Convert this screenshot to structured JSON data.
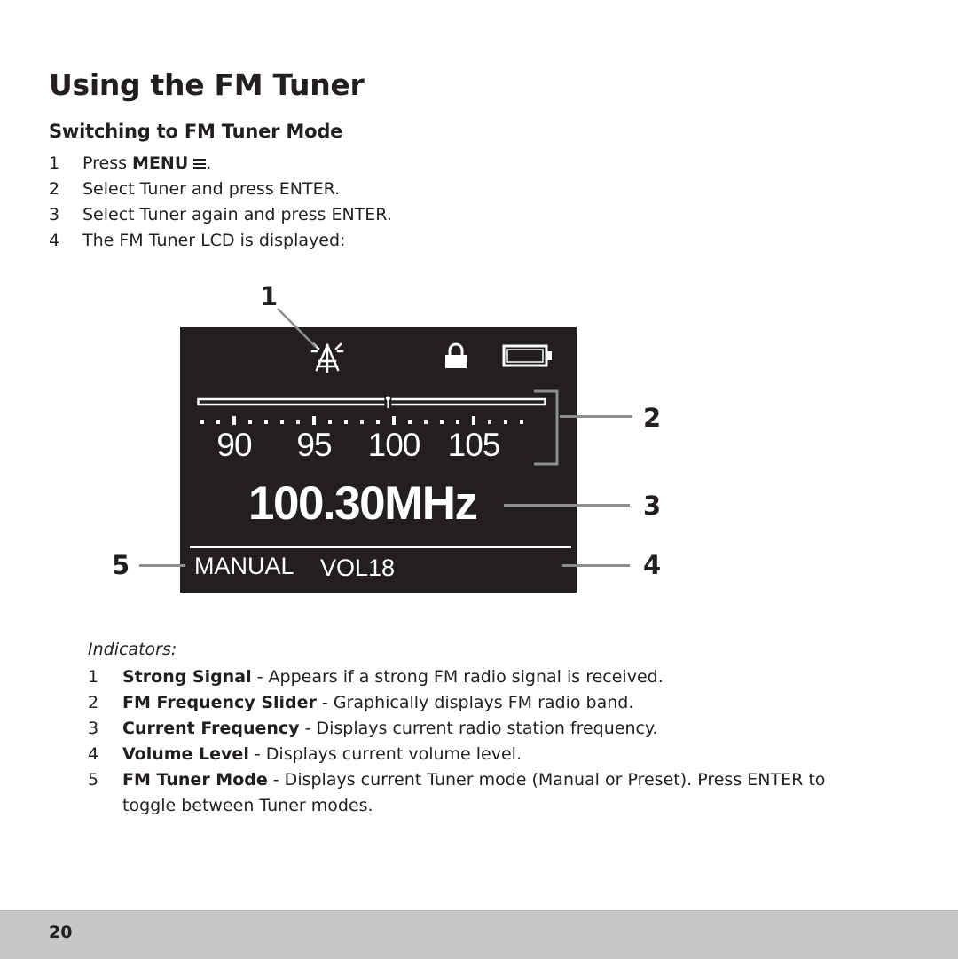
{
  "page": {
    "title": "Using the FM Tuner",
    "subtitle": "Switching to FM Tuner Mode",
    "page_number": "20"
  },
  "steps": [
    {
      "num": "1",
      "prefix": "Press ",
      "bold": "MENU",
      "icon": "menu-icon",
      "suffix": "."
    },
    {
      "num": "2",
      "text": "Select Tuner and press ENTER."
    },
    {
      "num": "3",
      "text": "Select Tuner again and press ENTER."
    },
    {
      "num": "4",
      "text": "The FM Tuner LCD is displayed:"
    }
  ],
  "lcd": {
    "icons": [
      "strong-signal-icon",
      "lock-icon",
      "battery-icon"
    ],
    "scale_labels": [
      "90",
      "95",
      "100",
      "105"
    ],
    "scale_range_mhz": [
      87.5,
      108
    ],
    "current_frequency_mhz": 100.3,
    "frequency_text": "100.30MHz",
    "mode": "MANUAL",
    "volume": "VOL18",
    "battery_level": 1.0
  },
  "callouts": [
    "1",
    "2",
    "3",
    "4",
    "5"
  ],
  "indicators": {
    "label": "Indicators:",
    "items": [
      {
        "num": "1",
        "term": "Strong Signal",
        "desc": " - Appears if a strong FM radio signal is received."
      },
      {
        "num": "2",
        "term": "FM Frequency Slider",
        "desc": " - Graphically displays FM radio band."
      },
      {
        "num": "3",
        "term": "Current Frequency",
        "desc": " - Displays current radio station frequency."
      },
      {
        "num": "4",
        "term": "Volume Level",
        "desc": " - Displays current volume level."
      },
      {
        "num": "5",
        "term": "FM Tuner Mode",
        "desc": " - Displays current Tuner mode (Manual or Preset). Press ENTER to toggle between Tuner modes."
      }
    ]
  },
  "colors": {
    "lcd_background": "#231f20",
    "lcd_foreground": "#ffffff",
    "leader_line": "#8c8e90",
    "footer_band": "#c6c7c8",
    "text": "#231f20"
  }
}
